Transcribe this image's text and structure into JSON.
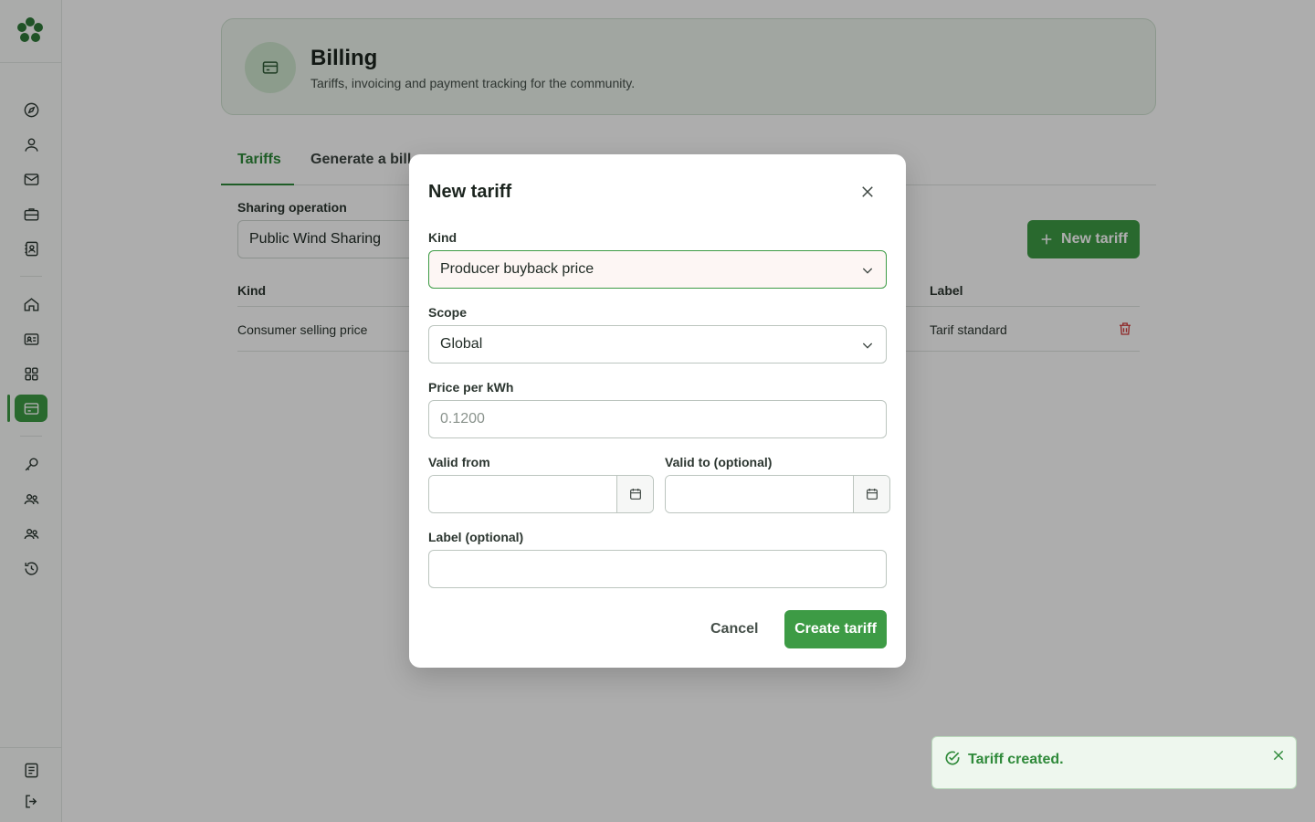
{
  "sidebar": {
    "items": [
      {
        "icon": "compass-icon"
      },
      {
        "icon": "user-icon"
      },
      {
        "icon": "mail-icon"
      },
      {
        "icon": "briefcase-icon"
      },
      {
        "icon": "contact-book-icon"
      },
      {
        "icon": "home-icon"
      },
      {
        "icon": "id-card-icon"
      },
      {
        "icon": "grid-icon"
      },
      {
        "icon": "billing-card-icon",
        "active": true
      },
      {
        "icon": "key-icon"
      },
      {
        "icon": "users-icon"
      },
      {
        "icon": "group-icon"
      },
      {
        "icon": "history-icon"
      },
      {
        "icon": "document-icon"
      },
      {
        "icon": "logout-icon"
      }
    ]
  },
  "header": {
    "title": "Billing",
    "subtitle": "Tariffs, invoicing and payment tracking for the community."
  },
  "tabs": [
    {
      "label": "Tariffs",
      "active": true
    },
    {
      "label": "Generate a bill"
    }
  ],
  "filters": {
    "sharing_label": "Sharing operation",
    "sharing_value": "Public Wind Sharing",
    "new_tariff_label": "New tariff"
  },
  "table": {
    "headers": {
      "kind": "Kind",
      "label": "Label"
    },
    "rows": [
      {
        "kind": "Consumer selling price",
        "label": "Tarif standard"
      }
    ]
  },
  "modal": {
    "title": "New tariff",
    "kind_label": "Kind",
    "kind_value": "Producer buyback price",
    "scope_label": "Scope",
    "scope_value": "Global",
    "price_label": "Price per kWh",
    "price_placeholder": "0.1200",
    "valid_from_label": "Valid from",
    "valid_to_label": "Valid to (optional)",
    "label_label": "Label (optional)",
    "cancel_label": "Cancel",
    "create_label": "Create tariff"
  },
  "toast": {
    "message": "Tariff created."
  },
  "colors": {
    "accent": "#3d9b45",
    "danger": "#d33b3b",
    "header_bg": "#eef5ee"
  }
}
